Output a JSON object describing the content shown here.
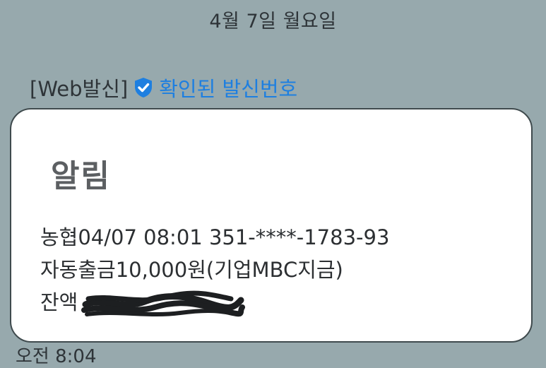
{
  "date_header": "4월 7일 월요일",
  "sender": {
    "prefix": "[Web발신]",
    "verified_icon": "shield-check-icon",
    "verified_label": "확인된 발신번호",
    "verified_color": "#1e7fe0"
  },
  "message": {
    "title": "알림",
    "lines": [
      "농협04/07 08:01 351-****-1783-93",
      "자동출금10,000원(기업MBC지금)"
    ],
    "balance_label": "잔액",
    "balance_redacted": true
  },
  "time": "오전 8:04",
  "colors": {
    "background": "#97a9ad",
    "bubble": "#ffffff",
    "bubble_border": "#3f4a4d"
  }
}
